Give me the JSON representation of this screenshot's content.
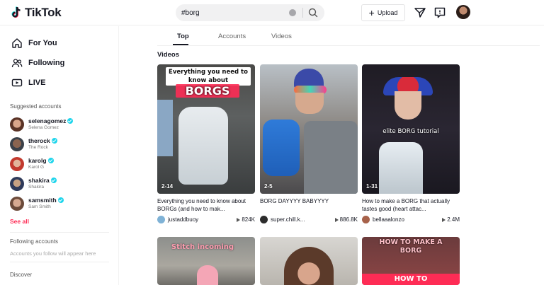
{
  "header": {
    "logo_text": "TikTok",
    "search_value": "#borg",
    "upload_label": "Upload"
  },
  "sidebar": {
    "nav": [
      {
        "label": "For You",
        "icon": "home-icon"
      },
      {
        "label": "Following",
        "icon": "people-icon"
      },
      {
        "label": "LIVE",
        "icon": "live-icon"
      }
    ],
    "suggested_title": "Suggested accounts",
    "accounts": [
      {
        "name": "selenagomez",
        "sub": "Selena Gomez",
        "verified": true
      },
      {
        "name": "therock",
        "sub": "The Rock",
        "verified": true
      },
      {
        "name": "karolg",
        "sub": "Karol G",
        "verified": true
      },
      {
        "name": "shakira",
        "sub": "Shakira",
        "verified": true
      },
      {
        "name": "samsmith",
        "sub": "Sam Smith",
        "verified": true
      }
    ],
    "see_all": "See all",
    "following_title": "Following accounts",
    "following_empty": "Accounts you follow will appear here",
    "discover_title": "Discover"
  },
  "tabs": [
    "Top",
    "Accounts",
    "Videos"
  ],
  "active_tab": "Top",
  "section_heading": "Videos",
  "videos": [
    {
      "overlay_top": "Everything you need to know about",
      "overlay_big": "BORGS",
      "thumb_count": "2-14",
      "title": "Everything you need to know about BORGs (and how to mak...",
      "author": "justaddbuoy",
      "views": "824K"
    },
    {
      "thumb_count": "2-5",
      "title": "BORG DAYYYY BABYYYY",
      "author": "super.chill.k...",
      "views": "886.8K"
    },
    {
      "overlay_caption": "elite BORG tutorial",
      "thumb_count": "1-31",
      "title": "How to make a BORG that actually tastes good (heart attac...",
      "author": "bellaaalonzo",
      "views": "2.4M"
    },
    {
      "overlay_caption": "Stitch incoming"
    },
    {},
    {
      "overlay_big": "HOW TO MAKE A BORG",
      "overlay_small": "HOW TO"
    }
  ],
  "colors": {
    "accent": "#fe2c55",
    "verified": "#20d5ec"
  }
}
